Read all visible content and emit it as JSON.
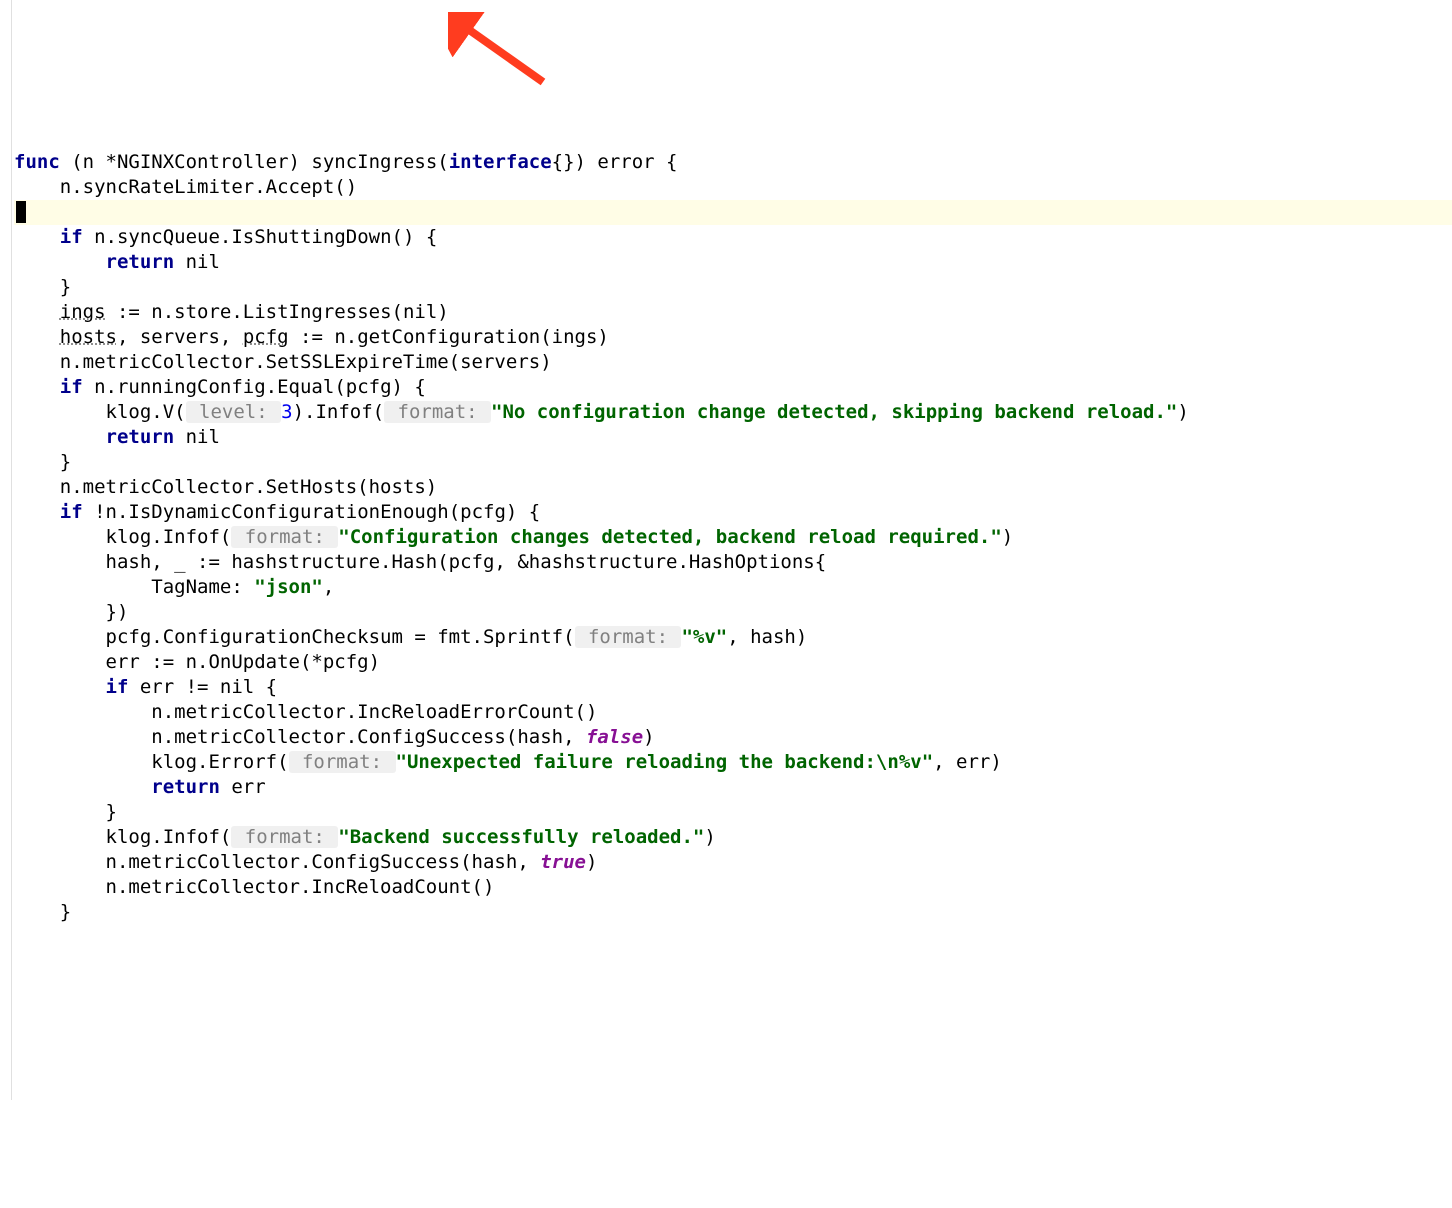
{
  "code": {
    "l1_func": "func",
    "l1_rest1": " (n *NGINXController) syncIngress(",
    "l1_interface": "interface",
    "l1_rest2": "{}) error {",
    "l2": "    n.syncRateLimiter.Accept()",
    "l3_empty": "",
    "l4": "    ",
    "l4_if": "if",
    "l4_rest": " n.syncQueue.IsShuttingDown() {",
    "l5": "        ",
    "l5_ret": "return",
    "l5_rest": " nil",
    "l6": "    }",
    "l7": "",
    "l8_pre": "    ",
    "l8_ings": "ings",
    "l8_rest": " := n.store.ListIngresses(nil)",
    "l9_pre": "    ",
    "l9_hosts": "hosts",
    "l9_mid": ", servers, ",
    "l9_pcfg": "pcfg",
    "l9_rest": " := n.getConfiguration(ings)",
    "l10": "",
    "l11": "    n.metricCollector.SetSSLExpireTime(servers)",
    "l12": "",
    "l13_pre": "    ",
    "l13_if": "if",
    "l13_rest": " n.runningConfig.Equal(pcfg) {",
    "l14_pre": "        klog.V(",
    "l14_hint": " level: ",
    "l14_num": "3",
    "l14_mid": ").Infof(",
    "l14_hint2": " format: ",
    "l14_str": "\"No configuration change detected, skipping backend reload.\"",
    "l14_end": ")",
    "l15_pre": "        ",
    "l15_ret": "return",
    "l15_rest": " nil",
    "l16": "    }",
    "l17": "",
    "l18": "    n.metricCollector.SetHosts(hosts)",
    "l19": "",
    "l20_pre": "    ",
    "l20_if": "if",
    "l20_rest": " !n.IsDynamicConfigurationEnough(pcfg) {",
    "l21_pre": "        klog.Infof(",
    "l21_hint": " format: ",
    "l21_str": "\"Configuration changes detected, backend reload required.\"",
    "l21_end": ")",
    "l22": "",
    "l23": "        hash, _ := hashstructure.Hash(pcfg, &hashstructure.HashOptions{",
    "l24_pre": "            TagName: ",
    "l24_str": "\"json\"",
    "l24_end": ",",
    "l25": "        })",
    "l26": "",
    "l27_pre": "        pcfg.ConfigurationChecksum = fmt.Sprintf(",
    "l27_hint": " format: ",
    "l27_str": "\"%v\"",
    "l27_end": ", hash)",
    "l28": "",
    "l29": "        err := n.OnUpdate(*pcfg)",
    "l30_pre": "        ",
    "l30_if": "if",
    "l30_rest": " err != nil {",
    "l31": "            n.metricCollector.IncReloadErrorCount()",
    "l32_pre": "            n.metricCollector.ConfigSuccess(hash, ",
    "l32_bool": "false",
    "l32_end": ")",
    "l33_pre": "            klog.Errorf(",
    "l33_hint": " format: ",
    "l33_str": "\"Unexpected failure reloading the backend:\\n%v\"",
    "l33_end": ", err)",
    "l34_pre": "            ",
    "l34_ret": "return",
    "l34_rest": " err",
    "l35": "        }",
    "l36": "",
    "l37_pre": "        klog.Infof(",
    "l37_hint": " format: ",
    "l37_str": "\"Backend successfully reloaded.\"",
    "l37_end": ")",
    "l38_pre": "        n.metricCollector.ConfigSuccess(hash, ",
    "l38_bool": "true",
    "l38_end": ")",
    "l39": "        n.metricCollector.IncReloadCount()",
    "l40": "    }"
  },
  "arrow_color": "#ff3c1f"
}
